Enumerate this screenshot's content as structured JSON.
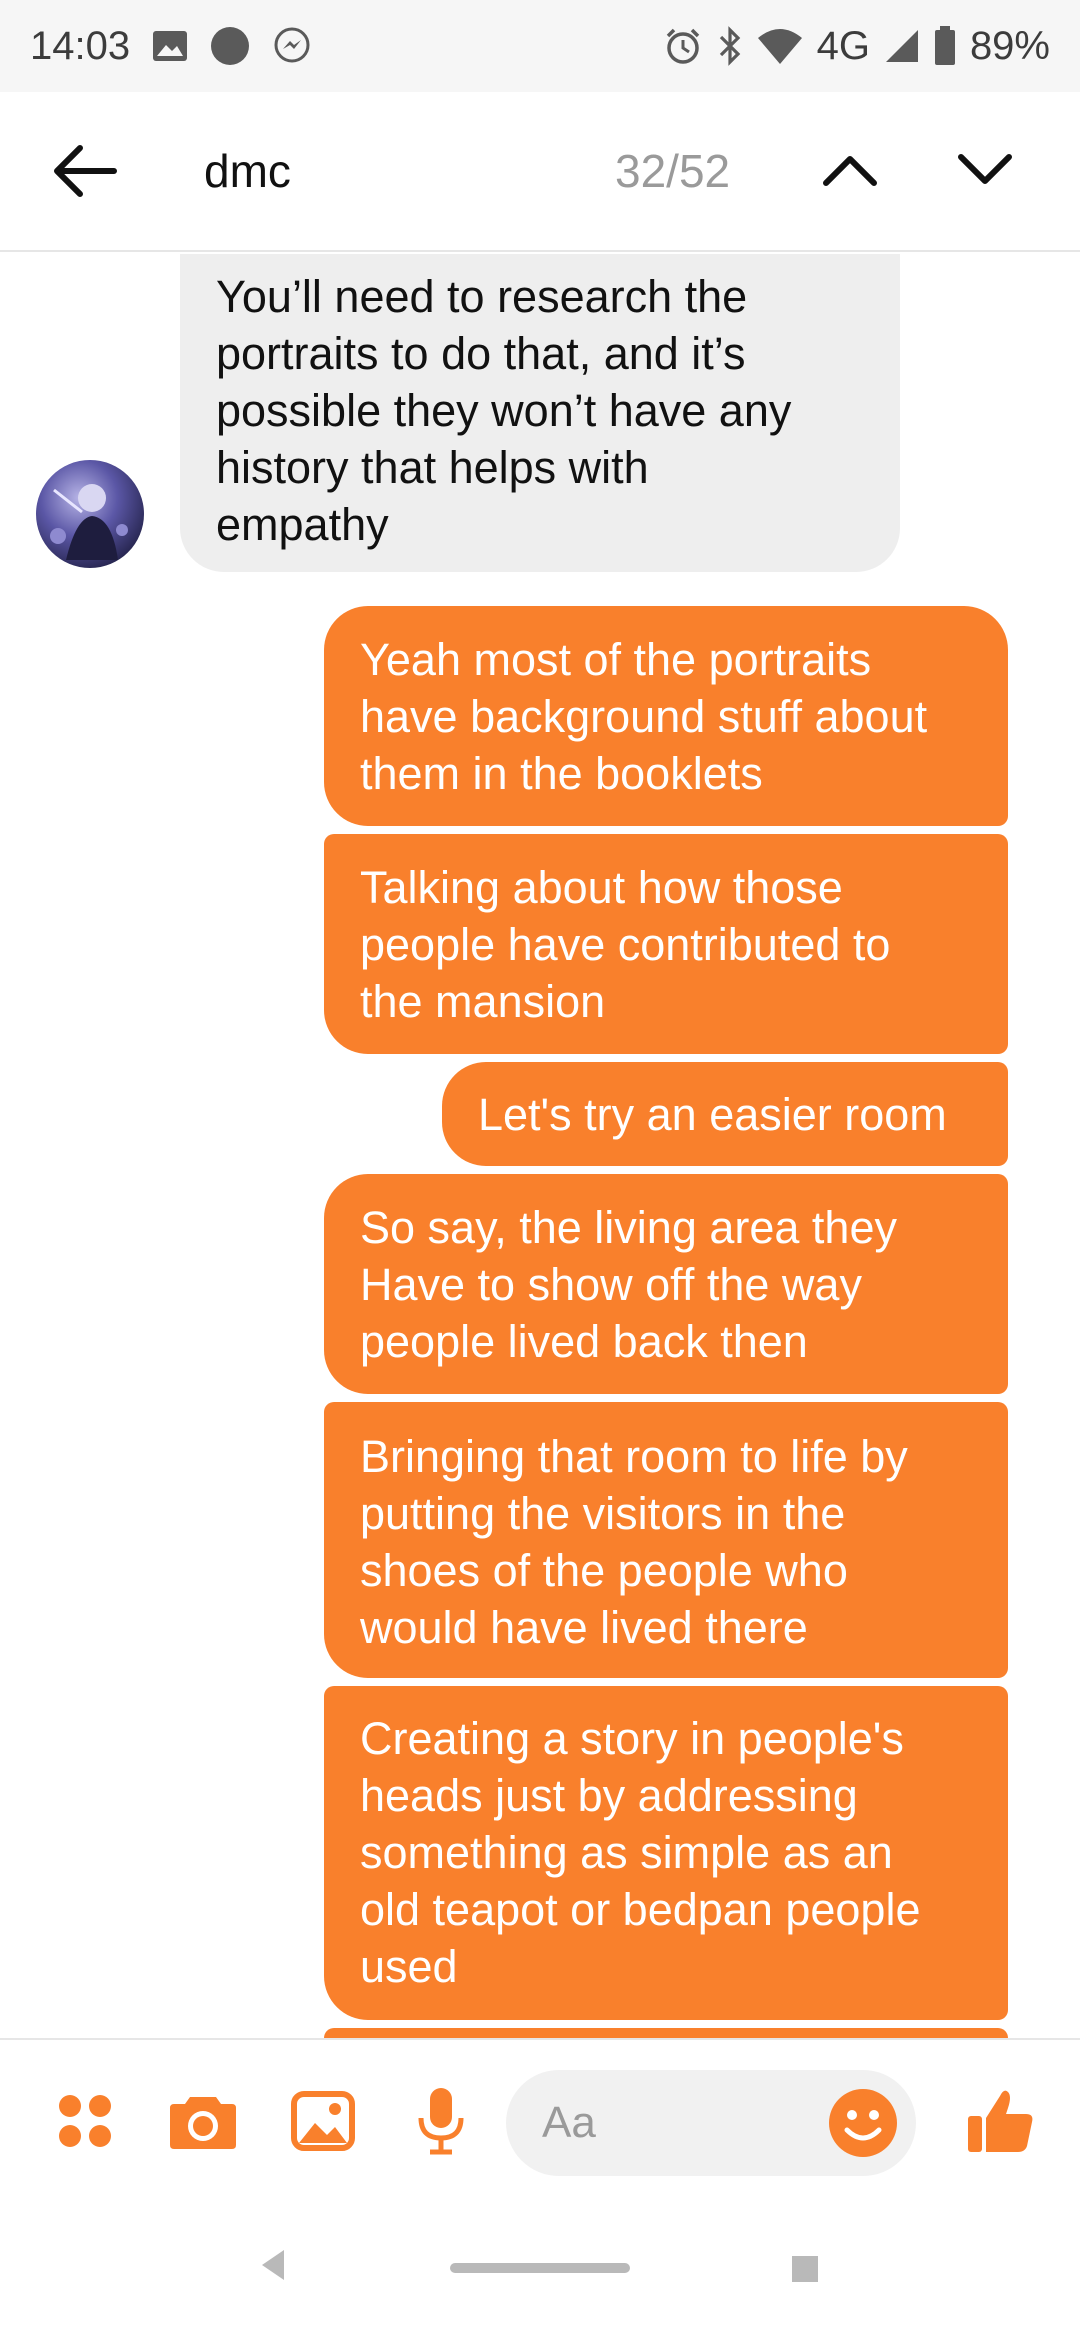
{
  "status_bar": {
    "time": "14:03",
    "network": "4G",
    "battery": "89%"
  },
  "header": {
    "search_query": "dmc",
    "result_count": "32/52"
  },
  "messages": [
    {
      "sender": "other",
      "text": "You’ll need to research the\nportraits to do that, and it’s\npossible they won’t have any\nhistory that helps with\nempathy"
    },
    {
      "sender": "me",
      "text": "Yeah most of the portraits\nhave background stuff about\nthem in the booklets"
    },
    {
      "sender": "me",
      "text": "Talking about how those\npeople have contributed to\nthe mansion"
    },
    {
      "sender": "me",
      "text": "Let's try an easier room"
    },
    {
      "sender": "me",
      "text": "So say, the living area they\nHave to show off the way\npeople lived back then"
    },
    {
      "sender": "me",
      "text": "Bringing that room to life by\nputting the visitors in the\nshoes of the people who\nwould have lived there"
    },
    {
      "sender": "me",
      "text": "Creating a story in people's\nheads just by addressing\nsomething as simple as an\nold teapot or bedpan people\nused"
    }
  ],
  "composer": {
    "placeholder": "Aa",
    "icons": [
      "apps-icon",
      "camera-icon",
      "gallery-icon",
      "microphone-icon",
      "emoji-icon",
      "thumbs-up-icon"
    ]
  },
  "colors": {
    "accent": "#f9802c",
    "incoming_bubble": "#eeeeee"
  }
}
